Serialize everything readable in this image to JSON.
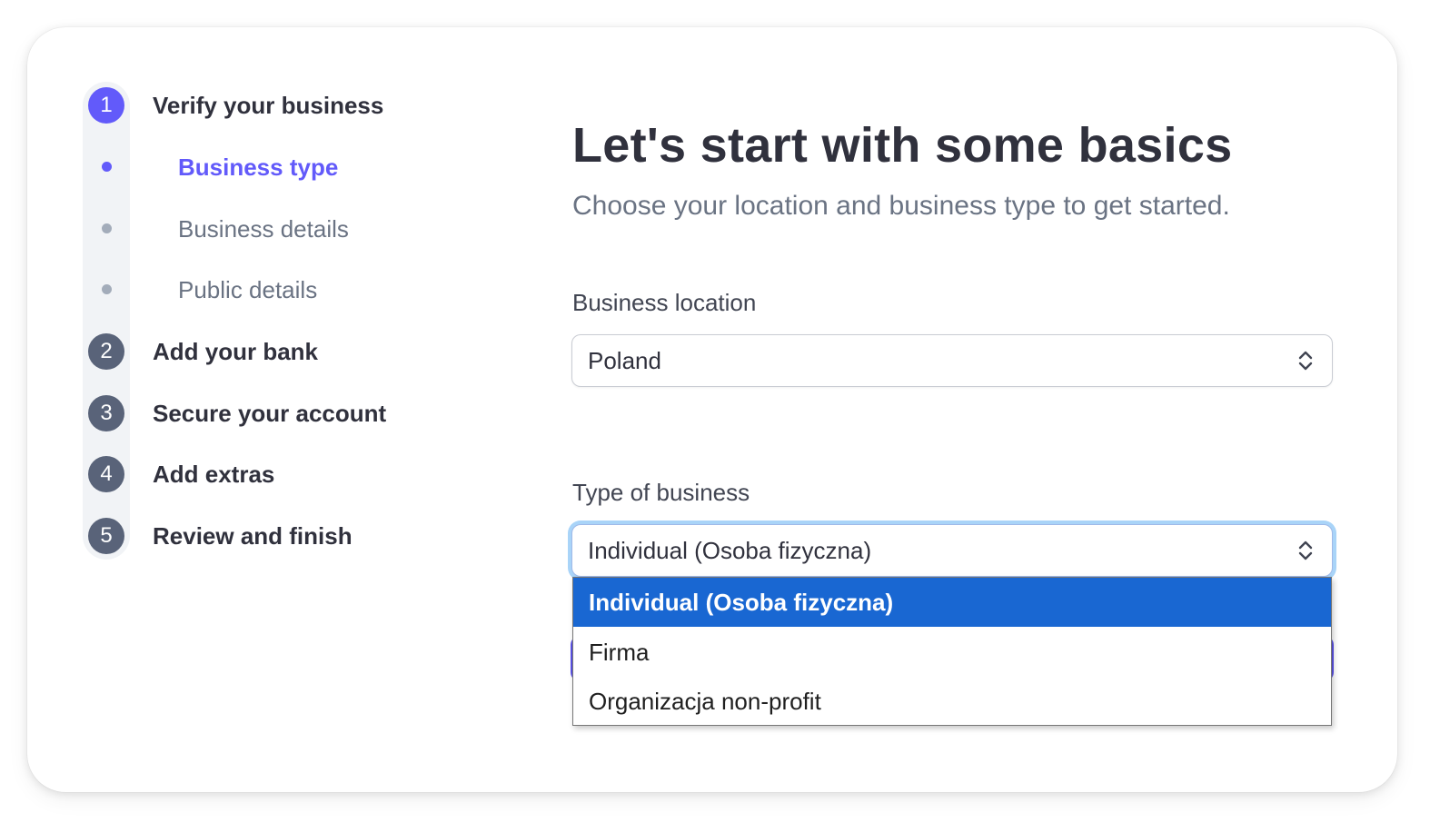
{
  "stepper": {
    "steps": [
      {
        "number": "1",
        "label": "Verify your business",
        "state": "active"
      },
      {
        "number": "2",
        "label": "Add your bank",
        "state": "pending"
      },
      {
        "number": "3",
        "label": "Secure your account",
        "state": "pending"
      },
      {
        "number": "4",
        "label": "Add extras",
        "state": "pending"
      },
      {
        "number": "5",
        "label": "Review and finish",
        "state": "pending"
      }
    ],
    "substeps": [
      {
        "label": "Business type",
        "state": "active"
      },
      {
        "label": "Business details",
        "state": "pending"
      },
      {
        "label": "Public details",
        "state": "pending"
      }
    ]
  },
  "main": {
    "title": "Let's start with some basics",
    "subtitle": "Choose your location and business type to get started.",
    "location": {
      "label": "Business location",
      "value": "Poland"
    },
    "business_type": {
      "label": "Type of business",
      "value": "Individual (Osoba fizyczna)",
      "options": [
        "Individual (Osoba fizyczna)",
        "Firma",
        "Organizacja non-profit"
      ],
      "selected_index": 0
    }
  },
  "colors": {
    "accent": "#625afa",
    "step_inactive": "#596379",
    "option_highlight": "#1967d2",
    "focus_ring": "#a9d4f8"
  }
}
